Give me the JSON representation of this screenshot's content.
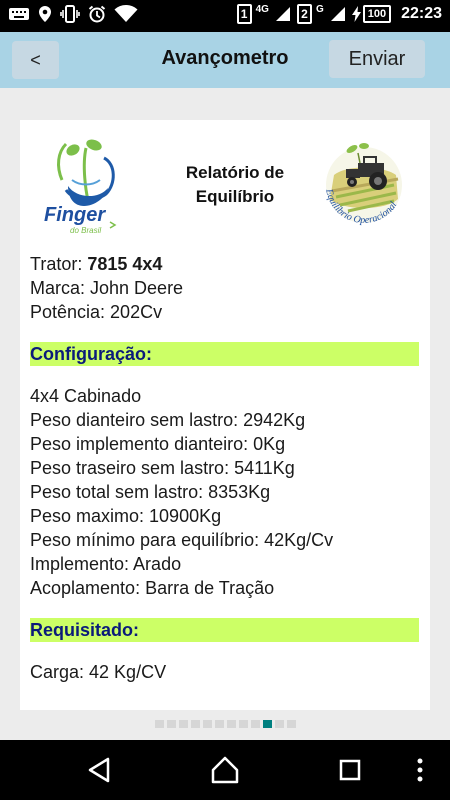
{
  "status_bar": {
    "sim1": "1",
    "sim1_network": "4G",
    "sim2": "2",
    "sim2_network": "G",
    "battery": "100",
    "time": "22:23"
  },
  "app_bar": {
    "back_label": "<",
    "title": "Avançometro",
    "send_label": "Enviar"
  },
  "report": {
    "title_line1": "Relatório de",
    "title_line2": "Equilíbrio",
    "logo_left": {
      "brand": "Finger",
      "sub": "do Brasil"
    },
    "logo_right": {
      "text": "Equilíbrio Operacional"
    },
    "tractor": {
      "model_label": "Trator: ",
      "model_value": "7815 4x4",
      "brand": "Marca: John Deere",
      "power": "Potência: 202Cv"
    },
    "configuracao": {
      "header": "Configuração:",
      "items": [
        "4x4 Cabinado",
        "Peso dianteiro sem lastro: 2942Kg",
        "Peso implemento dianteiro: 0Kg",
        "Peso traseiro sem lastro: 5411Kg",
        "Peso total sem lastro: 8353Kg",
        "Peso maximo: 10900Kg",
        "Peso mínimo para equilíbrio: 42Kg/Cv",
        "Implemento: Arado",
        "Acoplamento: Barra de Tração"
      ]
    },
    "requisitado": {
      "header": "Requisitado:",
      "items": [
        "Carga: 42 Kg/CV"
      ]
    }
  },
  "pager": {
    "total_pages": 12,
    "active_index": 9
  },
  "colors": {
    "app_bar": "#a9d3e5",
    "button": "#c6d8e3",
    "section_highlight": "#ccff66",
    "section_text": "#0b1b7a",
    "pager_active": "#008080"
  }
}
